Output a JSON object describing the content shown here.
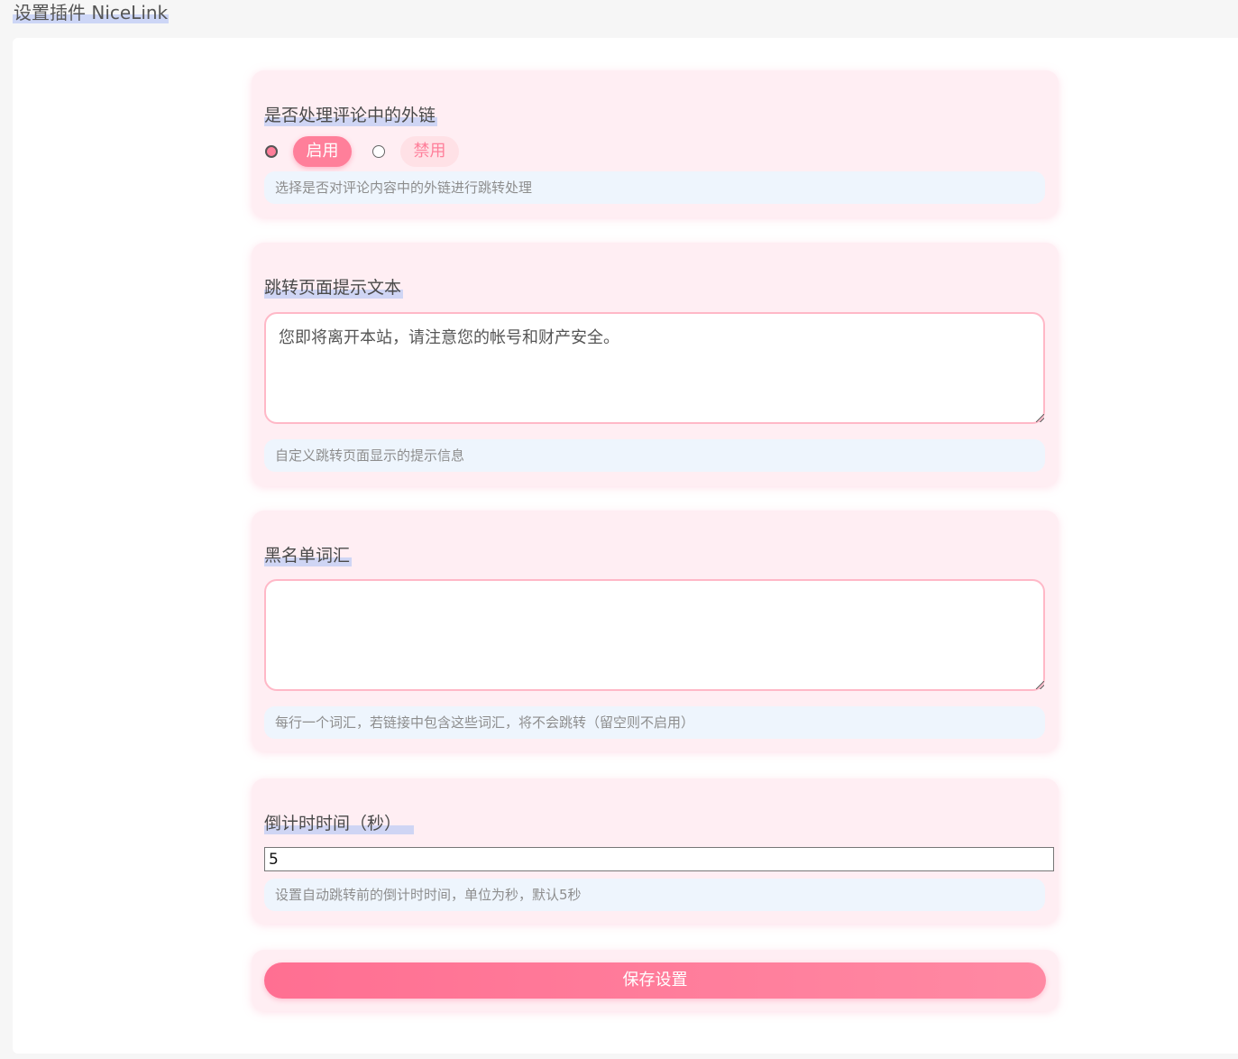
{
  "page": {
    "title": "设置插件 NiceLink"
  },
  "comment_links": {
    "label": "是否处理评论中的外链",
    "options": [
      {
        "label": "启用",
        "selected": true
      },
      {
        "label": "禁用",
        "selected": false
      }
    ],
    "help": "选择是否对评论内容中的外链进行跳转处理"
  },
  "redirect_text": {
    "label": "跳转页面提示文本",
    "value": "您即将离开本站，请注意您的帐号和财产安全。",
    "help": "自定义跳转页面显示的提示信息"
  },
  "blacklist": {
    "label": "黑名单词汇",
    "value": "",
    "help": "每行一个词汇，若链接中包含这些词汇，将不会跳转（留空则不启用）"
  },
  "countdown": {
    "label": "倒计时时间（秒）",
    "value": "5",
    "help": "设置自动跳转前的倒计时时间，单位为秒，默认5秒"
  },
  "actions": {
    "save_label": "保存设置"
  },
  "colors": {
    "accent": "#ff7f9a",
    "card_bg": "#ffeef3",
    "help_bg": "#eef5fd",
    "label_highlight": "#cfd5f4"
  }
}
